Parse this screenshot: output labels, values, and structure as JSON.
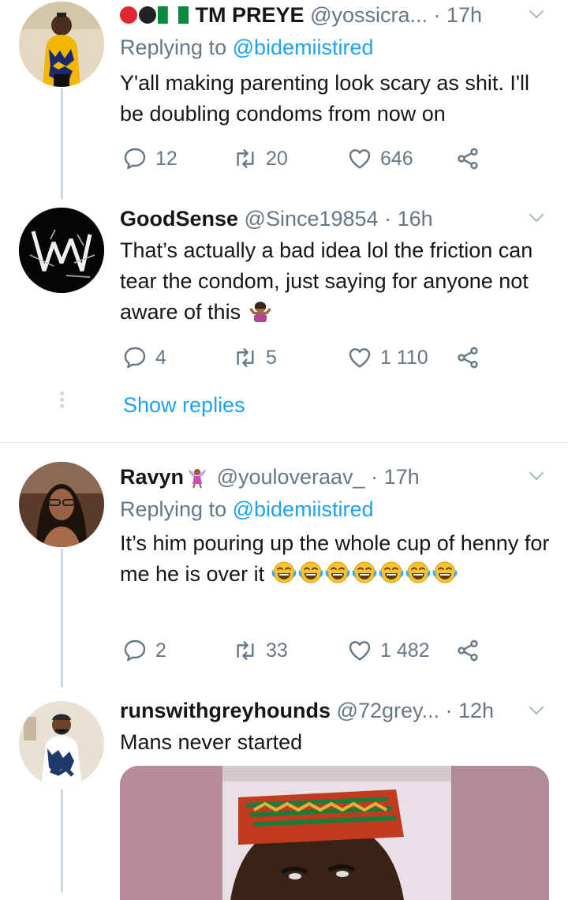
{
  "tweets": [
    {
      "display_name": "TM PREYE",
      "handle": "@yossicra...",
      "time": "17h",
      "replying_label": "Replying to",
      "replying_to": "@bidemiistired",
      "text": "Y'all making parenting look scary as shit. I'll be doubling condoms from now on",
      "replies": "12",
      "retweets": "20",
      "likes": "646"
    },
    {
      "display_name": "GoodSense",
      "handle": "@Since19854",
      "time": "16h",
      "text": "That’s actually a bad idea lol the friction can tear the condom, just saying for anyone not aware of this",
      "replies": "4",
      "retweets": "5",
      "likes": "1 110",
      "show_replies": "Show replies"
    },
    {
      "display_name": "Ravyn",
      "handle": "@youloveraav_",
      "time": "17h",
      "replying_label": "Replying to",
      "replying_to": "@bidemiistired",
      "text": "It’s him pouring up the whole cup of henny for me he is over it",
      "replies": "2",
      "retweets": "33",
      "likes": "1 482"
    },
    {
      "display_name": "runswithgreyhounds",
      "handle": "@72grey...",
      "time": "12h",
      "text": "Mans never started"
    }
  ],
  "icons": {
    "reply": "reply-icon",
    "retweet": "retweet-icon",
    "like": "heart-icon",
    "share": "share-icon",
    "caret": "chevron-down-icon"
  },
  "colors": {
    "link": "#1da1f2",
    "muted": "#657786",
    "text": "#14171a"
  }
}
